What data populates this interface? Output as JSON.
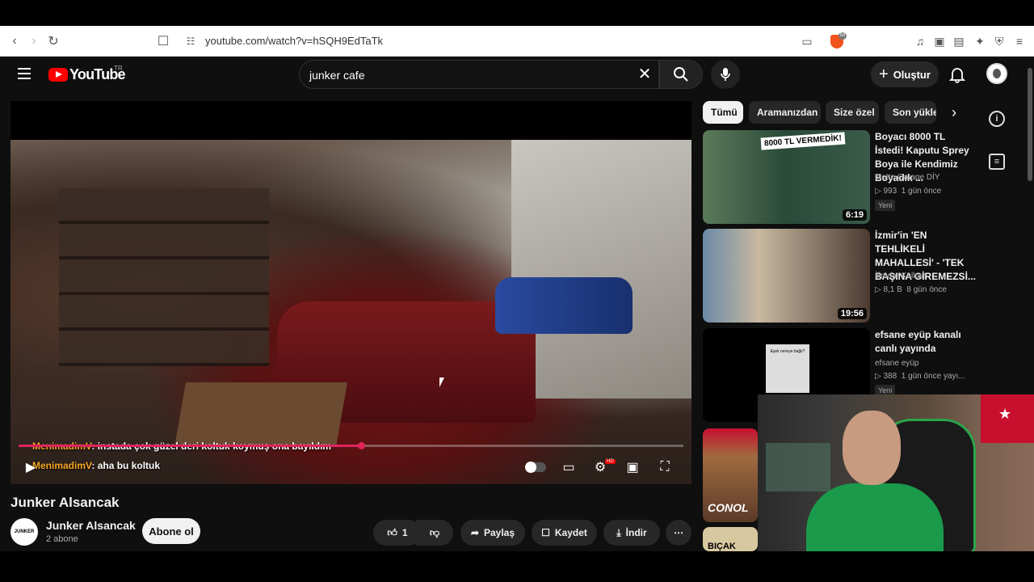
{
  "browser": {
    "url": "youtube.com/watch?v=hSQH9EdTaTk",
    "brave_badge": "59"
  },
  "header": {
    "logo_text": "YouTube",
    "country_code": "TR",
    "search_query": "junker cafe",
    "create_label": "Oluştur"
  },
  "player": {
    "chat": [
      {
        "user": "MenimadimV",
        "message": ": instada çok güzel deri koltuk koymuş ona bayıldım"
      },
      {
        "user": "MenimadimV",
        "message": ": aha bu koltuk"
      }
    ],
    "progress": 0.51,
    "hd_label": "HD"
  },
  "video": {
    "title": "Junker Alsancak",
    "channel_name": "Junker Alsancak",
    "channel_logo_text": "JUNKER",
    "subscribers": "2 abone",
    "subscribe_label": "Abone ol",
    "likes": "1",
    "share_label": "Paylaş",
    "save_label": "Kaydet",
    "download_label": "İndir"
  },
  "chips": [
    "Tümü",
    "Aramanızdan",
    "Size özel",
    "Son yükle"
  ],
  "recommendations": [
    {
      "title": "Boyacı 8000 TL İstedi! Kaputu Sprey Boya ile Kendimiz Boyadık ...",
      "channel": "Motto Garage DİY",
      "views": "993",
      "age": "1 gün önce",
      "badge": "Yeni",
      "duration": "6:19",
      "thumb_text": "8000 TL VERMEDİK!"
    },
    {
      "title": "İzmir'in 'EN TEHLİKELİ MAHALLESİ' - 'TEK BAŞINA GİREMEZSİ...",
      "channel": "İlimdar Kalkan",
      "views": "8,1 B",
      "age": "8 gün önce",
      "badge": "",
      "duration": "19:56",
      "thumb_text": ""
    },
    {
      "title": "efsane eyüp kanalı canlı yayında",
      "channel": "efsane eyüp",
      "views": "388",
      "age": "1 gün önce yayı...",
      "badge": "Yeni",
      "duration": "",
      "thumb_text": "Eşek nereye bağlı?"
    },
    {
      "title": "",
      "channel": "",
      "views": "",
      "age": "",
      "badge": "",
      "duration": "",
      "thumb_text": "CONOL"
    },
    {
      "title": "",
      "channel": "",
      "views": "",
      "age": "",
      "badge": "",
      "duration": "",
      "thumb_text": "BIÇAK"
    }
  ],
  "colors": {
    "yt_bg": "#0f0f0f",
    "accent_red": "#ff0000",
    "progress": "#e0245e",
    "chat_user": "#f4a623"
  }
}
